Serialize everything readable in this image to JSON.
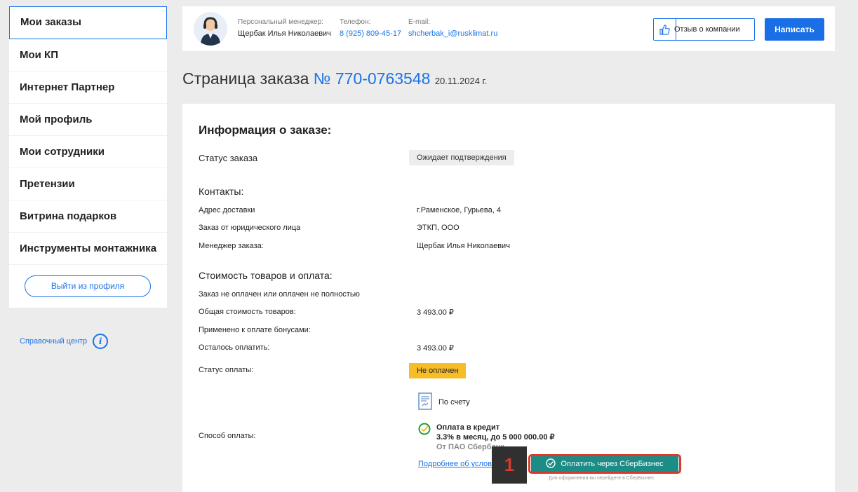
{
  "sidebar": {
    "items": [
      {
        "label": "Мои заказы"
      },
      {
        "label": "Мои КП"
      },
      {
        "label": "Интернет Партнер"
      },
      {
        "label": "Мой профиль"
      },
      {
        "label": "Мои сотрудники"
      },
      {
        "label": "Претензии"
      },
      {
        "label": "Витрина подарков"
      },
      {
        "label": "Инструменты монтажника"
      }
    ],
    "logout_label": "Выйти из профиля",
    "help_label": "Справочный центр"
  },
  "header": {
    "manager_label": "Персональный менеджер:",
    "manager_name": "Щербак Илья Николаевич",
    "phone_label": "Телефон:",
    "phone": "8 (925) 809-45-17",
    "email_label": "E-mail:",
    "email": "shcherbak_i@rusklimat.ru",
    "review_label": "Отзыв о компании",
    "write_label": "Написать"
  },
  "title": {
    "prefix": "Страница заказа",
    "number": "№ 770-0763548",
    "date": "20.11.2024 г."
  },
  "order": {
    "heading": "Информация о заказе:",
    "status_label": "Статус заказа",
    "status_value": "Ожидает подтверждения",
    "contacts_heading": "Контакты:",
    "address_label": "Адрес доставки",
    "address_value": "г.Раменское, Гурьева, 4",
    "legal_label": "Заказ от юридического лица",
    "legal_value": "ЭТКП, ООО",
    "manager_label": "Менеджер заказа:",
    "manager_value": "Щербак Илья Николаевич",
    "payment_heading": "Стоимость товаров и оплата:",
    "unpaid_note": "Заказ не оплачен или оплачен не полностью",
    "total_label": "Общая стоимость товаров:",
    "total_value": "3 493.00 ₽",
    "bonus_label": "Применено к оплате бонусами:",
    "remaining_label": "Осталось оплатить:",
    "remaining_value": "3 493.00 ₽",
    "pay_status_label": "Статус оплаты:",
    "pay_status_value": "Не оплачен",
    "pay_method_label": "Способ оплаты:",
    "invoice_label": "По счету",
    "credit_title": "Оплата в кредит",
    "credit_terms": "3.3% в месяц, до 5 000 000.00 ₽",
    "credit_bank": "От ПАО Сбербанк",
    "more_link": "Подробнее об условиях",
    "sber_button": "Оплатить через СберБизнес",
    "sber_note": "Для оформления вы перейдете в СберБизнес"
  },
  "step_marker": "1",
  "colors": {
    "accent": "#1a73e8",
    "sber": "#1b8c86",
    "warning": "#f7bd28",
    "highlight": "#d93a2b"
  }
}
